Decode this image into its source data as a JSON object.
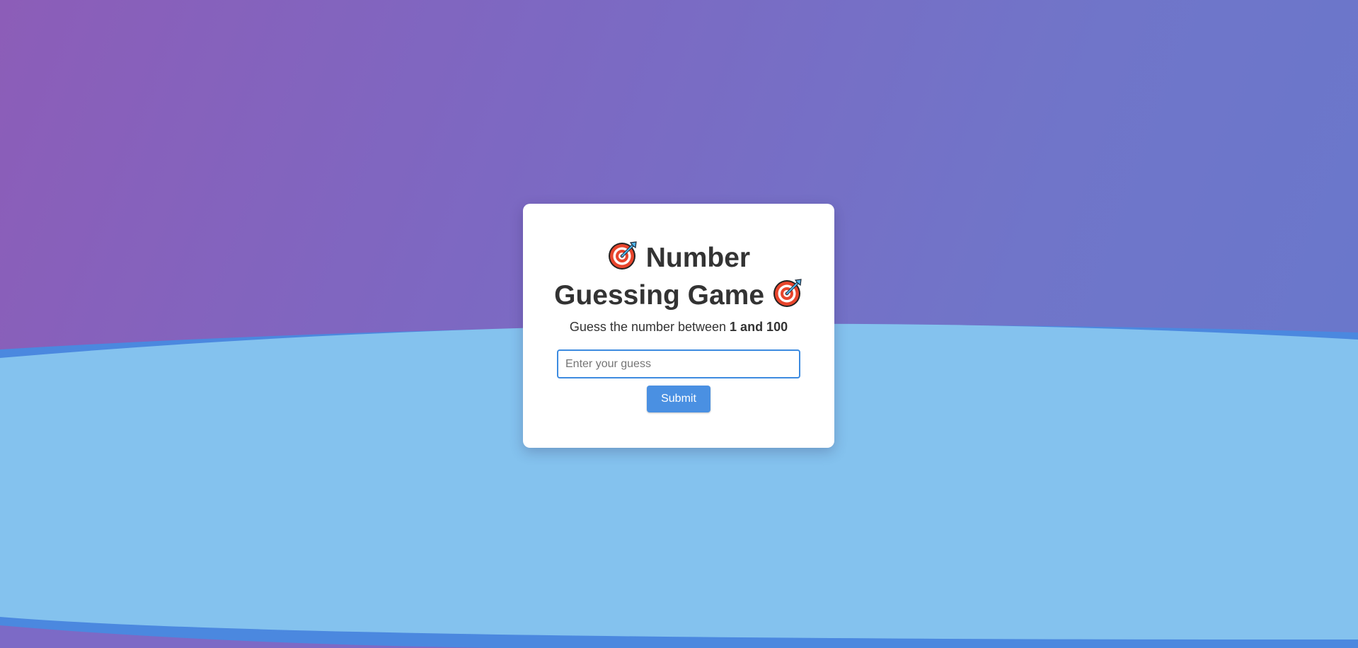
{
  "game": {
    "title_text": "Number Guessing Game",
    "subtitle_prefix": "Guess the number between ",
    "subtitle_range": "1 and 100",
    "input_placeholder": "Enter your guess",
    "submit_label": "Submit"
  },
  "icons": {
    "title_icon": "direct-hit-target-emoji"
  },
  "colors": {
    "background_gradient_start": "#8c5db8",
    "background_gradient_end": "#6878cc",
    "wave_light": "#84c2ee",
    "wave_dark": "#4b88df",
    "card": "#ffffff",
    "button": "#4a90e2",
    "input_border": "#3d8be0",
    "text": "#333333"
  }
}
